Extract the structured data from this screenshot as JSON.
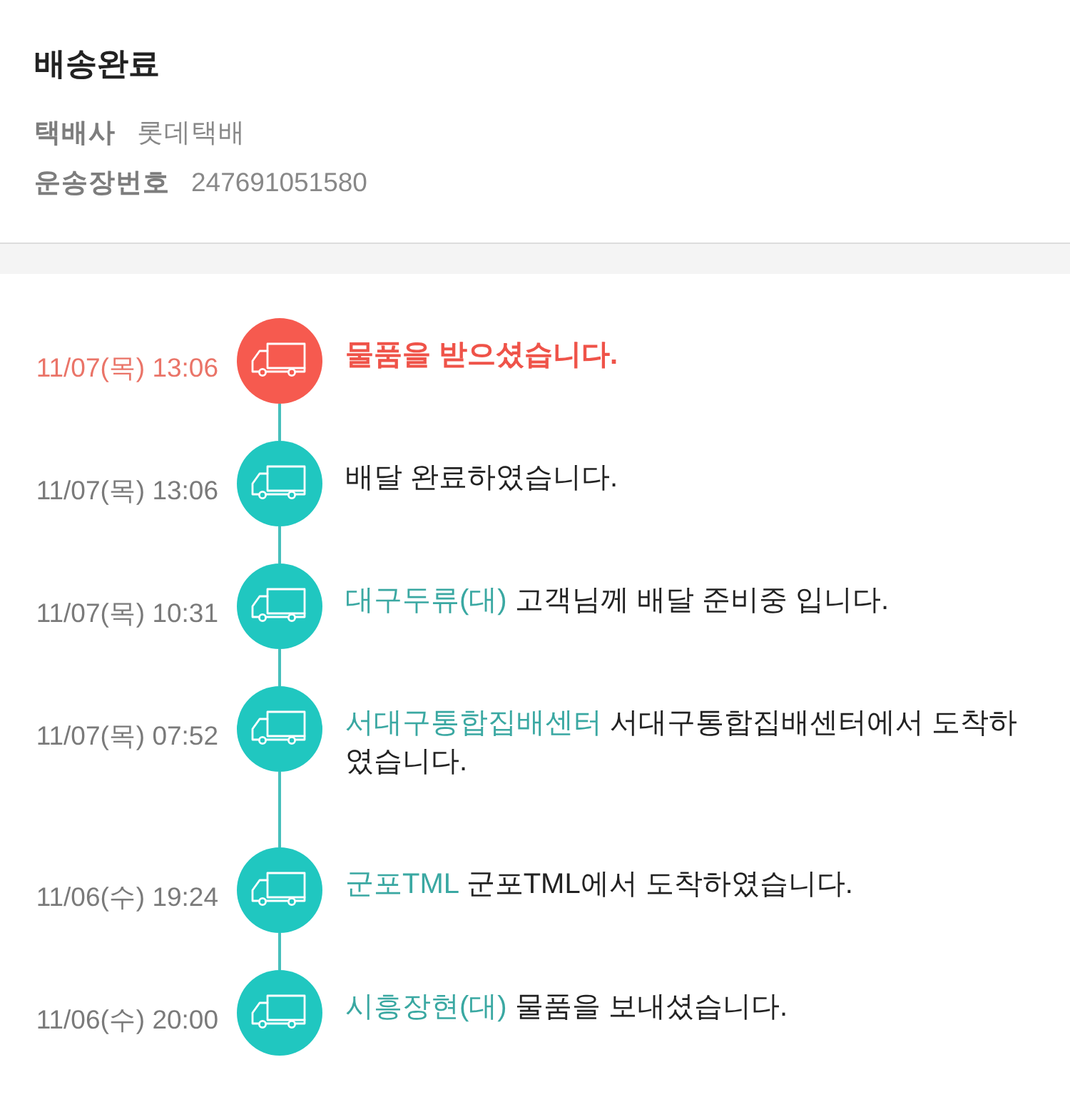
{
  "header": {
    "title": "배송완료",
    "fields": [
      {
        "label": "택배사",
        "value": "롯데택배"
      },
      {
        "label": "운송장번호",
        "value": "247691051580"
      }
    ]
  },
  "events": [
    {
      "time": "11/07(목) 13:06",
      "message": "물품을 받으셨습니다.",
      "current": true
    },
    {
      "time": "11/07(목) 13:06",
      "message": "배달 완료하였습니다.",
      "current": false
    },
    {
      "time": "11/07(목) 10:31",
      "location": "대구두류(대)",
      "message": "고객님께 배달 준비중 입니다.",
      "current": false
    },
    {
      "time": "11/07(목) 07:52",
      "location": "서대구통합집배센터",
      "message": "서대구통합집배센터에서 도착하였습니다.",
      "current": false
    },
    {
      "time": "11/06(수) 19:24",
      "location": "군포TML",
      "message": "군포TML에서 도착하였습니다.",
      "current": false
    },
    {
      "time": "11/06(수) 20:00",
      "location": "시흥장현(대)",
      "message": "물품을 보내셨습니다.",
      "current": false
    }
  ]
}
